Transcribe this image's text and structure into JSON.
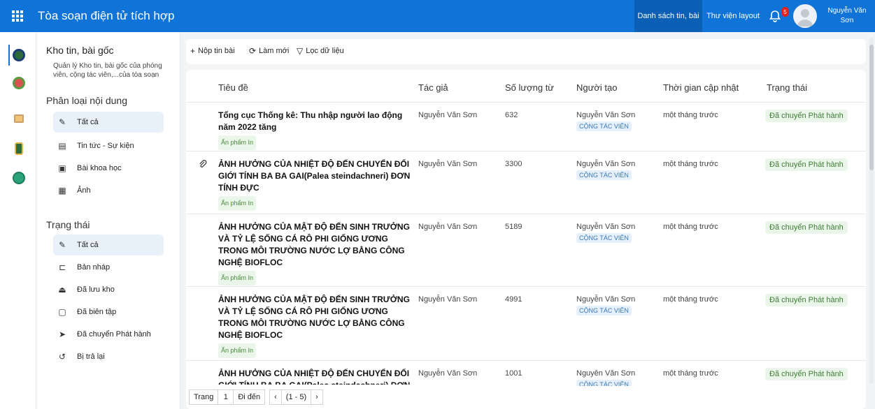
{
  "topbar": {
    "title": "Tòa soạn điện tử tích hợp",
    "nav": [
      "Danh sách tin, bài",
      "Thư viện layout"
    ],
    "notification_count": "5",
    "user_name": "Nguyễn Văn Sơn"
  },
  "sidebar": {
    "title": "Kho tin, bài gốc",
    "description": "Quản lý Kho tin, bài gốc của phóng viên, cộng tác viên,...của tòa soạn",
    "sections": [
      {
        "label": "Phân loại nội dung",
        "items": [
          {
            "label": "Tất cả",
            "icon": "pen-icon",
            "active": true
          },
          {
            "label": "Tin tức - Sự kiện",
            "icon": "news-icon"
          },
          {
            "label": "Bài khoa học",
            "icon": "document-icon"
          },
          {
            "label": "Ảnh",
            "icon": "image-file-icon"
          }
        ]
      },
      {
        "label": "Trạng thái",
        "items": [
          {
            "label": "Tất cả",
            "icon": "pen-icon",
            "active": true
          },
          {
            "label": "Bản nháp",
            "icon": "draft-icon"
          },
          {
            "label": "Đã lưu kho",
            "icon": "archive-icon"
          },
          {
            "label": "Đã biên tập",
            "icon": "edit-doc-icon"
          },
          {
            "label": "Đã chuyển Phát hành",
            "icon": "send-icon"
          },
          {
            "label": "Bị trả lại",
            "icon": "undo-icon"
          }
        ]
      }
    ]
  },
  "toolbar": {
    "new_label": "Nộp tin bài",
    "refresh_label": "Làm mới",
    "filter_label": "Lọc dữ liệu"
  },
  "table": {
    "columns": [
      "Tiêu đề",
      "Tác giả",
      "Số lượng từ",
      "Người tạo",
      "Thời gian cập nhật",
      "Trạng thái"
    ],
    "rows": [
      {
        "title": "Tổng cục Thống kê: Thu nhập người lao động năm 2022 tăng",
        "tag": "Ấn phẩm In",
        "author": "Nguyễn Văn Sơn",
        "words": "632",
        "creator": "Nguyễn Văn Sơn",
        "role": "CỘNG TÁC VIÊN",
        "updated": "một tháng trước",
        "status": "Đã chuyển Phát hành",
        "attachment": false
      },
      {
        "title": "ẢNH HƯỞNG CỦA NHIỆT ĐỘ ĐẾN CHUYỂN ĐỔI GIỚI TÍNH BA BA GAI(Palea steindachneri) ĐƠN TÍNH ĐỰC",
        "tag": "Ấn phẩm In",
        "author": "Nguyễn Văn Sơn",
        "words": "3300",
        "creator": "Nguyễn Văn Sơn",
        "role": "CỘNG TÁC VIÊN",
        "updated": "một tháng trước",
        "status": "Đã chuyển Phát hành",
        "attachment": true
      },
      {
        "title": "ẢNH HƯỞNG CỦA MẬT ĐỘ ĐẾN SINH TRƯỞNG VÀ TỶ LỆ SỐNG CÁ RÔ PHI GIỐNG ƯƠNG TRONG MÔI TRƯỜNG NƯỚC LỢ BẰNG CÔNG NGHỆ BIOFLOC",
        "tag": "Ấn phẩm In",
        "author": "Nguyễn Văn Sơn",
        "words": "5189",
        "creator": "Nguyễn Văn Sơn",
        "role": "CỘNG TÁC VIÊN",
        "updated": "một tháng trước",
        "status": "Đã chuyển Phát hành",
        "attachment": false
      },
      {
        "title": "ẢNH HƯỞNG CỦA MẬT ĐỘ ĐẾN SINH TRƯỞNG VÀ TỶ LỆ SỐNG CÁ RÔ PHI GIỐNG ƯƠNG TRONG MÔI TRƯỜNG NƯỚC LỢ BẰNG CÔNG NGHỆ BIOFLOC",
        "tag": "Ấn phẩm In",
        "author": "Nguyễn Văn Sơn",
        "words": "4991",
        "creator": "Nguyễn Văn Sơn",
        "role": "CỘNG TÁC VIÊN",
        "updated": "một tháng trước",
        "status": "Đã chuyển Phát hành",
        "attachment": false
      },
      {
        "title": "ẢNH HƯỞNG CỦA NHIỆT ĐỘ ĐẾN CHUYỂN ĐỔI GIỚI TÍNH BA BA GAI(Palea steindachneri) ĐƠN",
        "tag": "",
        "author": "Nguyễn Văn Sơn",
        "words": "1001",
        "creator": "Nguyễn Văn Sơn",
        "role": "CỘNG TÁC VIÊN",
        "updated": "một tháng trước",
        "status": "Đã chuyển Phát hành",
        "attachment": false
      }
    ]
  },
  "pager": {
    "page_label": "Trang",
    "page_value": "1",
    "goto_label": "Đi đến",
    "range": "(1 - 5)"
  },
  "colors": {
    "brand": "#0f73d8",
    "status_bg": "#eaf6e9",
    "badge": "#e3231b"
  }
}
